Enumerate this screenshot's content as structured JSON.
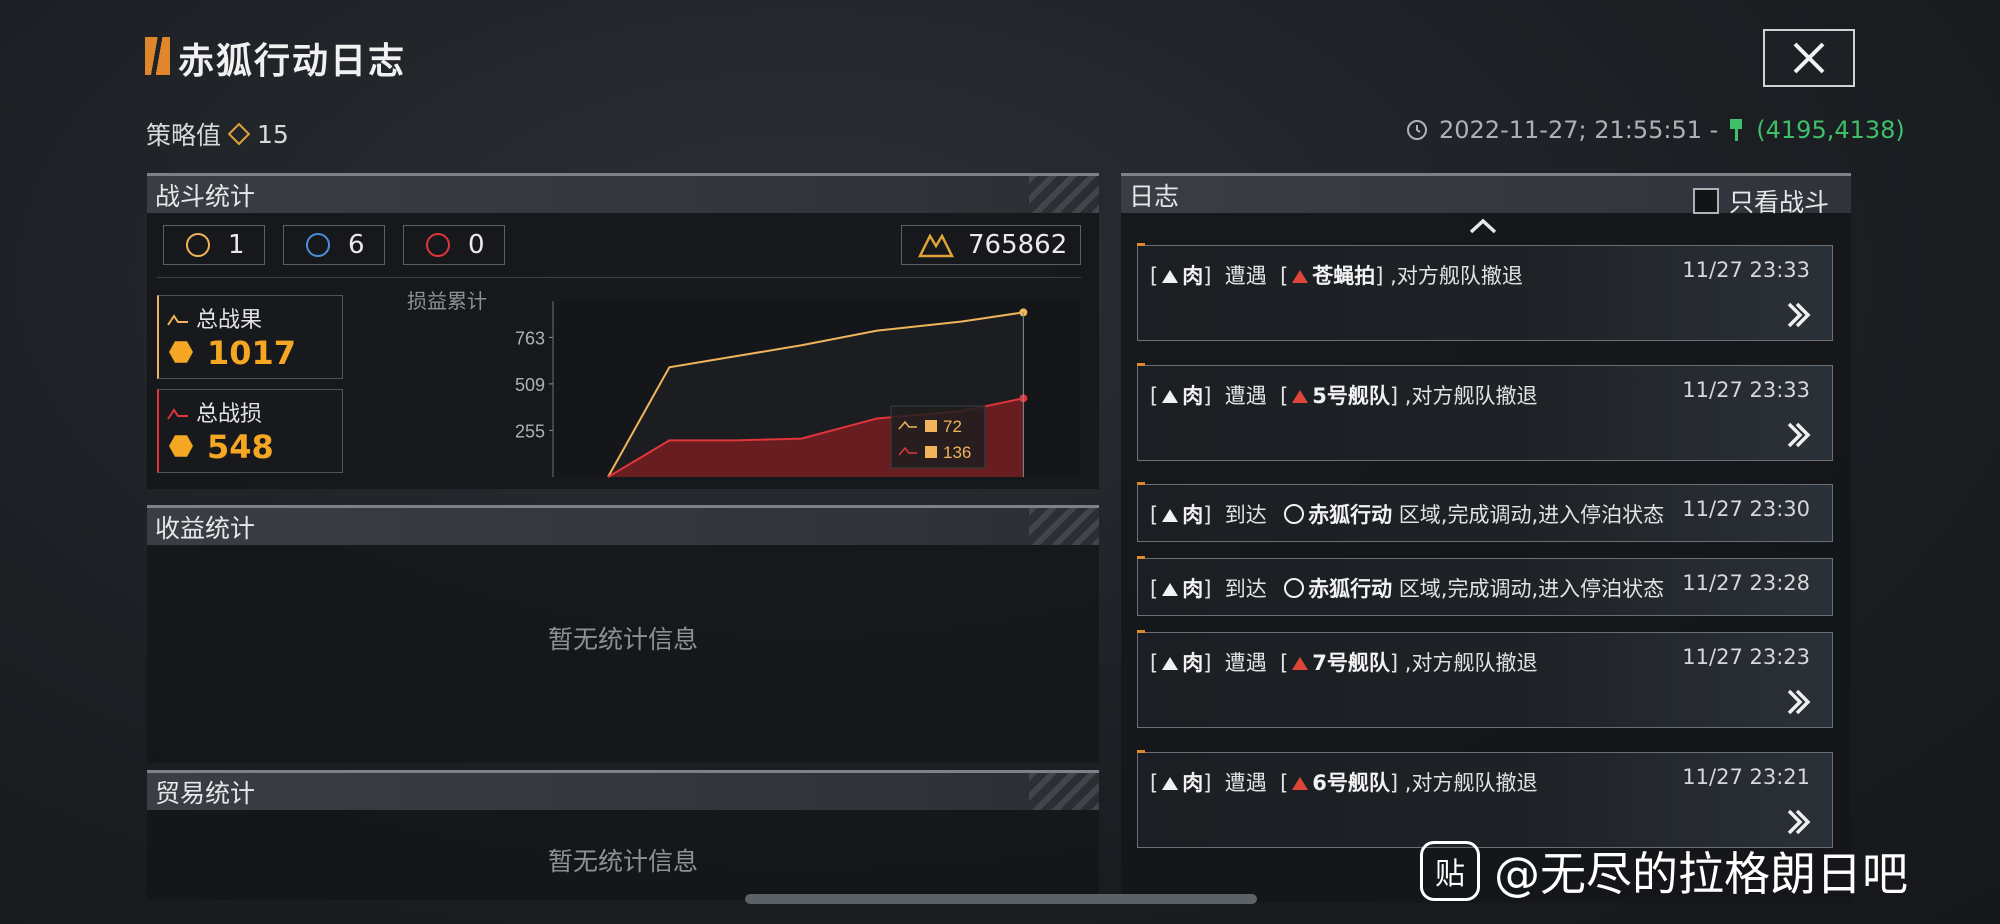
{
  "header": {
    "title": "赤狐行动日志",
    "strategy_label": "策略值",
    "strategy_value": "15",
    "timestamp": "2022-11-27; 21:55:51 -",
    "coords": "(4195,4138)"
  },
  "battle": {
    "title": "战斗统计",
    "stat_a": "1",
    "stat_b": "6",
    "stat_c": "0",
    "exp": "765862",
    "total_gain_label": "总战果",
    "total_gain": "1017",
    "total_loss_label": "总战损",
    "total_loss": "548",
    "chart_title": "损益累计",
    "legend_gain": "72",
    "legend_loss": "136"
  },
  "chart_data": {
    "type": "area",
    "title": "损益累计",
    "yticks": [
      255,
      509,
      763
    ],
    "series": [
      {
        "name": "",
        "color": "#f0b45a",
        "values": [
          0,
          600,
          660,
          720,
          800,
          850,
          900
        ]
      },
      {
        "name": "",
        "color": "#e0353a",
        "values": [
          0,
          200,
          200,
          210,
          320,
          360,
          430
        ]
      }
    ]
  },
  "income": {
    "title": "收益统计",
    "empty": "暂无统计信息"
  },
  "trade": {
    "title": "贸易统计",
    "empty": "暂无统计信息"
  },
  "log": {
    "title": "日志",
    "only_battle": "只看战斗",
    "entries": [
      {
        "actor": "肉",
        "verb": "遭遇",
        "target": "苍蝇拍",
        "tail": ",对方舰队撤退",
        "time": "11/27 23:33"
      },
      {
        "actor": "肉",
        "verb": "遭遇",
        "target": "5号舰队",
        "tail": ",对方舰队撤退",
        "time": "11/27 23:33"
      },
      {
        "actor": "肉",
        "verb": "到达",
        "target": "赤狐行动",
        "tail": "区域,完成调动,进入停泊状态",
        "time": "11/27 23:30"
      },
      {
        "actor": "肉",
        "verb": "到达",
        "target": "赤狐行动",
        "tail": "区域,完成调动,进入停泊状态",
        "time": "11/27 23:28"
      },
      {
        "actor": "肉",
        "verb": "遭遇",
        "target": "7号舰队",
        "tail": ",对方舰队撤退",
        "time": "11/27 23:23"
      },
      {
        "actor": "肉",
        "verb": "遭遇",
        "target": "6号舰队",
        "tail": ",对方舰队撤退",
        "time": "11/27 23:21"
      }
    ]
  },
  "watermark": "@无尽的拉格朗日吧",
  "watermark_logo": "贴"
}
